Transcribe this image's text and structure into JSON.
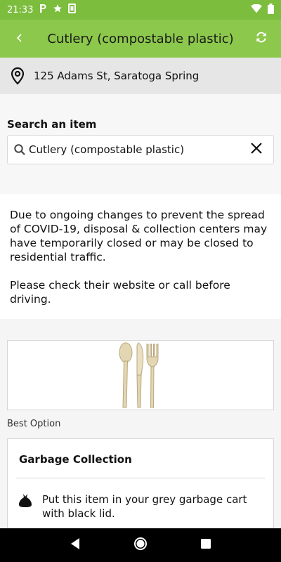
{
  "status_bar": {
    "time": "21:33"
  },
  "app_bar": {
    "title": "Cutlery (compostable plastic)"
  },
  "location": {
    "address": "125 Adams St, Saratoga Spring"
  },
  "search": {
    "label": "Search an item",
    "value": "Cutlery (compostable plastic)"
  },
  "notice": {
    "paragraph1": "Due to ongoing changes to prevent the spread of COVID-19, disposal & collection centers may have temporarily closed or may be closed to residential traffic.",
    "paragraph2": "Please check their website or call before driving."
  },
  "result": {
    "best_option_label": "Best Option",
    "option_title": "Garbage Collection",
    "instruction": "Put this item in your grey garbage cart with black lid."
  },
  "colors": {
    "status_bar": "#7cbd3e",
    "app_bar": "#8cc84b"
  },
  "icons": [
    "p-icon",
    "star-icon",
    "sim-icon",
    "wifi-icon",
    "battery-icon",
    "back-arrow-icon",
    "refresh-icon",
    "location-pin-icon",
    "search-icon",
    "clear-icon",
    "garbage-bag-icon",
    "nav-back-icon",
    "nav-home-icon",
    "nav-recents-icon"
  ]
}
